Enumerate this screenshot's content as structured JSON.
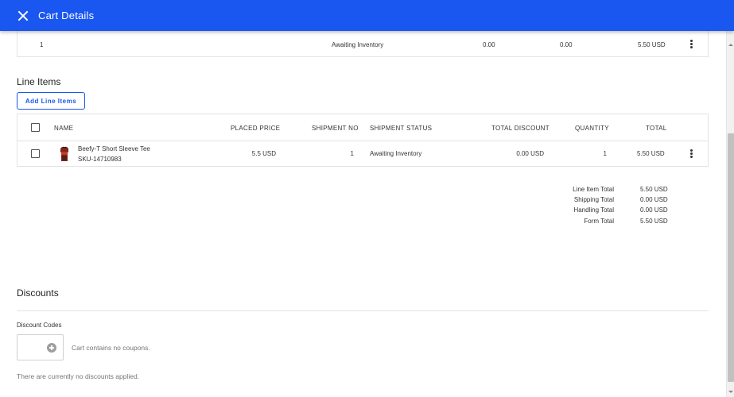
{
  "window": {
    "title": "Cart Details",
    "close_icon": "close-icon"
  },
  "shipment_row": {
    "number": "1",
    "status": "Awaiting Inventory",
    "col_a": "0.00",
    "col_b": "0.00",
    "total": "5.50 USD",
    "menu_icon": "more-vert-icon"
  },
  "line_items": {
    "title": "Line Items",
    "add_button": "Add Line Items",
    "columns": {
      "name": "NAME",
      "placed_price": "PLACED PRICE",
      "shipment_no": "SHIPMENT NO",
      "shipment_status": "SHIPMENT STATUS",
      "total_discount": "TOTAL DISCOUNT",
      "quantity": "QUANTITY",
      "total": "TOTAL"
    },
    "rows": [
      {
        "name": "Beefy-T Short Sleeve Tee",
        "sku": "SKU-14710983",
        "placed_price": "5.5 USD",
        "shipment_no": "1",
        "shipment_status": "Awaiting Inventory",
        "total_discount": "0.00 USD",
        "quantity": "1",
        "total": "5.50 USD",
        "image_icon": "tshirt-product-image"
      }
    ]
  },
  "totals": {
    "line_item_total_label": "Line Item Total",
    "line_item_total": "5.50 USD",
    "shipping_total_label": "Shipping Total",
    "shipping_total": "0.00 USD",
    "handling_total_label": "Handling Total",
    "handling_total": "0.00 USD",
    "form_total_label": "Form Total",
    "form_total": "5.50 USD"
  },
  "discounts": {
    "title": "Discounts",
    "codes_label": "Discount Codes",
    "no_coupons": "Cart contains no coupons.",
    "no_discounts": "There are currently no discounts applied.",
    "add_icon": "add-circle-icon"
  },
  "colors": {
    "brand": "#1a56f0",
    "text": "#212121",
    "muted": "#757575",
    "border": "#e3e3e3"
  }
}
